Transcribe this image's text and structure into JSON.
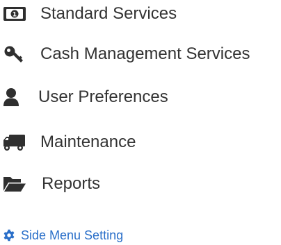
{
  "menu": {
    "items": [
      {
        "label": "Standard Services",
        "icon": "money-bill-icon"
      },
      {
        "label": "Cash Management Services",
        "icon": "key-icon"
      },
      {
        "label": "User Preferences",
        "icon": "user-icon"
      },
      {
        "label": "Maintenance",
        "icon": "truck-icon"
      },
      {
        "label": "Reports",
        "icon": "folder-open-icon"
      }
    ],
    "settings_link": {
      "label": "Side Menu Setting",
      "icon": "gear-icon"
    }
  },
  "colors": {
    "text": "#333333",
    "icon": "#2f2f2f",
    "link": "#2a6fc9"
  }
}
